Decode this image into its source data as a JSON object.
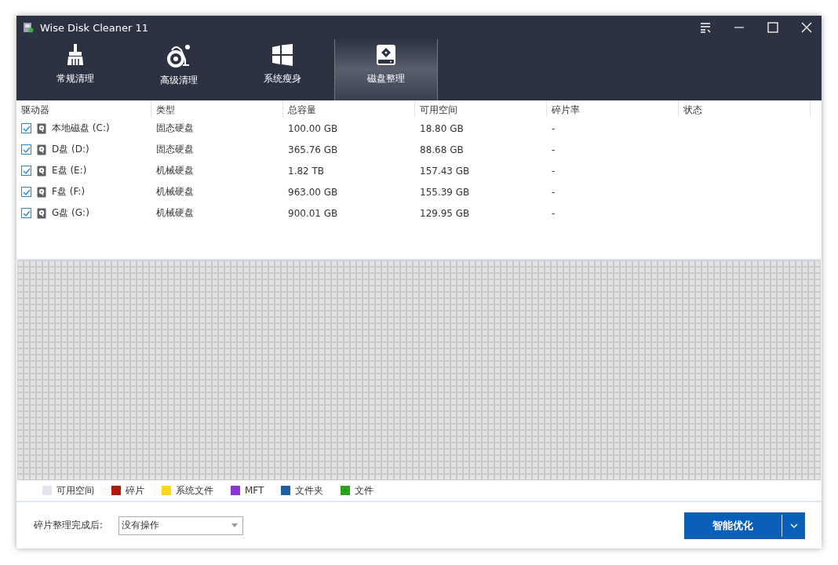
{
  "window": {
    "title": "Wise Disk Cleaner 11"
  },
  "tabs": [
    {
      "label": "常规清理",
      "kind": "broom",
      "selected": false
    },
    {
      "label": "高级清理",
      "kind": "vacuum",
      "selected": false
    },
    {
      "label": "系统瘦身",
      "kind": "windows",
      "selected": false
    },
    {
      "label": "磁盘整理",
      "kind": "disk",
      "selected": true
    }
  ],
  "table": {
    "columns": [
      "驱动器",
      "类型",
      "总容量",
      "可用空间",
      "碎片率",
      "状态"
    ],
    "rows": [
      {
        "drive": "本地磁盘 (C:)",
        "checked": true,
        "type": "固态硬盘",
        "total": "100.00 GB",
        "free": "18.80 GB",
        "fragmentation": "-"
      },
      {
        "drive": "D盘 (D:)",
        "checked": true,
        "type": "固态硬盘",
        "total": "365.76 GB",
        "free": "88.68 GB",
        "fragmentation": "-"
      },
      {
        "drive": "E盘 (E:)",
        "checked": true,
        "type": "机械硬盘",
        "total": "1.82 TB",
        "free": "157.43 GB",
        "fragmentation": "-"
      },
      {
        "drive": "F盘 (F:)",
        "checked": true,
        "type": "机械硬盘",
        "total": "963.00 GB",
        "free": "155.39 GB",
        "fragmentation": "-"
      },
      {
        "drive": "G盘 (G:)",
        "checked": true,
        "type": "机械硬盘",
        "total": "900.01 GB",
        "free": "129.95 GB",
        "fragmentation": "-"
      }
    ]
  },
  "legend": [
    {
      "label": "可用空间",
      "color": "#e3e6ee"
    },
    {
      "label": "碎片",
      "color": "#b01a0c"
    },
    {
      "label": "系统文件",
      "color": "#fcd617"
    },
    {
      "label": "MFT",
      "color": "#8a35d4"
    },
    {
      "label": "文件夹",
      "color": "#1f5ea6"
    },
    {
      "label": "文件",
      "color": "#2aa01c"
    }
  ],
  "footer": {
    "after_label": "碎片整理完成后:",
    "after_value": "没有操作",
    "button": "智能优化"
  }
}
